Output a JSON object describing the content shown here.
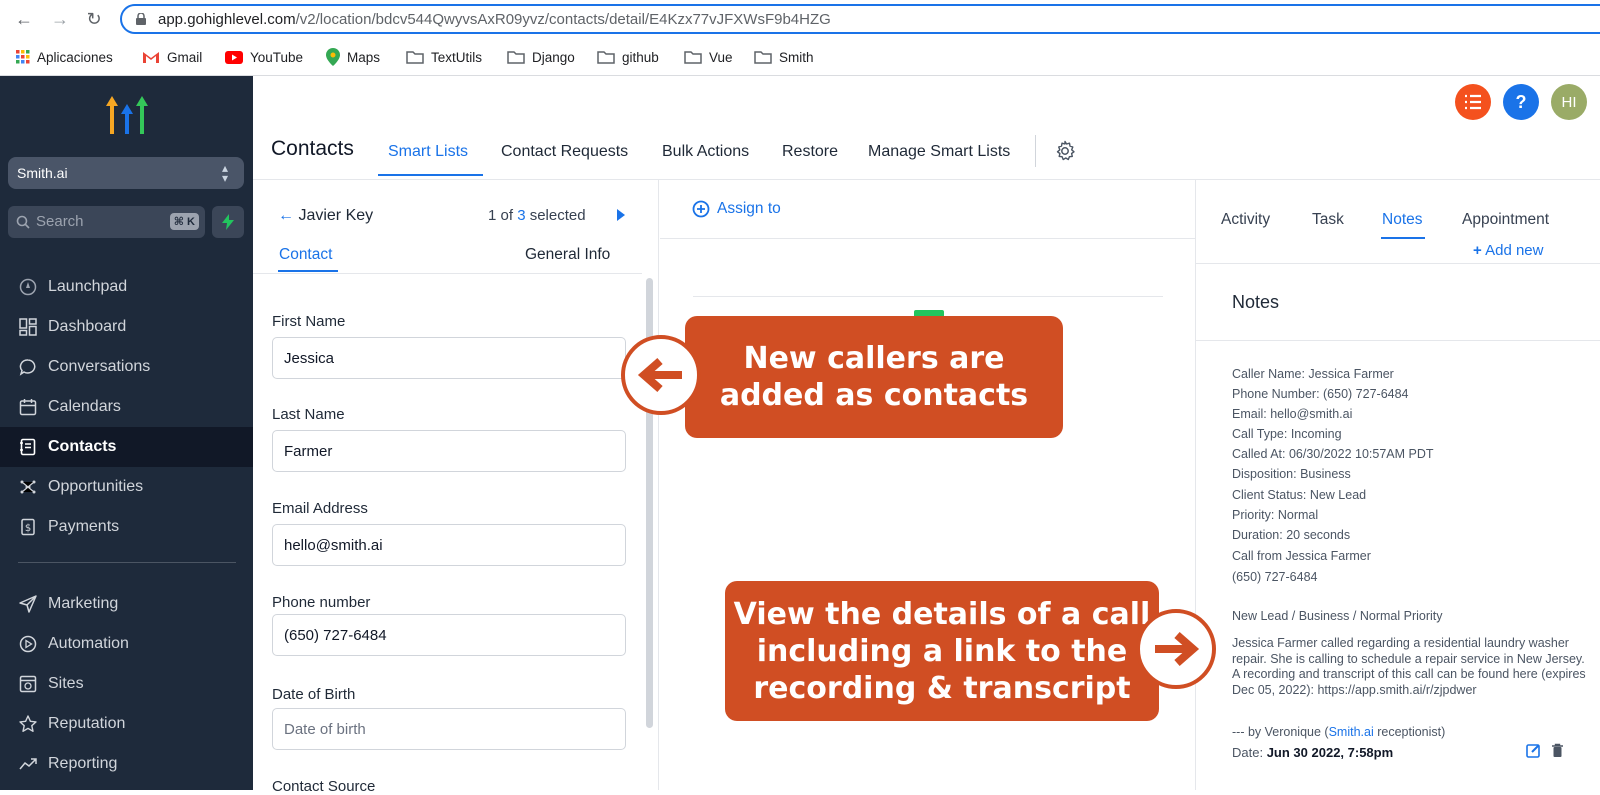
{
  "browser": {
    "url_host": "app.gohighlevel.com",
    "url_path": "/v2/location/bdcv544QwyvsAxR09yvz/contacts/detail/E4Kzx77vJFXWsF9b4HZG",
    "bookmarks": [
      "Aplicaciones",
      "Gmail",
      "YouTube",
      "Maps",
      "TextUtils",
      "Django",
      "github",
      "Vue",
      "Smith"
    ]
  },
  "sidebar": {
    "account": "Smith.ai",
    "search_placeholder": "Search",
    "search_shortcut": "⌘ K",
    "items": [
      {
        "label": "Launchpad",
        "icon": "rocket-icon"
      },
      {
        "label": "Dashboard",
        "icon": "dashboard-icon"
      },
      {
        "label": "Conversations",
        "icon": "chat-icon"
      },
      {
        "label": "Calendars",
        "icon": "calendar-icon"
      },
      {
        "label": "Contacts",
        "icon": "contacts-icon"
      },
      {
        "label": "Opportunities",
        "icon": "opportunities-icon"
      },
      {
        "label": "Payments",
        "icon": "payments-icon"
      },
      {
        "label": "Marketing",
        "icon": "send-icon"
      },
      {
        "label": "Automation",
        "icon": "automation-icon"
      },
      {
        "label": "Sites",
        "icon": "sites-icon"
      },
      {
        "label": "Reputation",
        "icon": "star-icon"
      },
      {
        "label": "Reporting",
        "icon": "trend-icon"
      }
    ],
    "active": "Contacts"
  },
  "header": {
    "title": "Contacts",
    "tabs": [
      "Smart Lists",
      "Contact Requests",
      "Bulk Actions",
      "Restore",
      "Manage Smart Lists"
    ],
    "active_tab": "Smart Lists",
    "avatar_initials": "HI",
    "help_label": "?"
  },
  "contact_panel": {
    "back_label": "Javier Key",
    "count_prefix": "1 of",
    "count_num": "3",
    "count_suffix": "selected",
    "tabs": [
      "Contact",
      "General Info"
    ],
    "fields": [
      {
        "label": "First Name",
        "value": "Jessica",
        "placeholder": ""
      },
      {
        "label": "Last Name",
        "value": "Farmer",
        "placeholder": ""
      },
      {
        "label": "Email Address",
        "value": "hello@smith.ai",
        "placeholder": ""
      },
      {
        "label": "Phone number",
        "value": "(650) 727-6484",
        "placeholder": ""
      },
      {
        "label": "Date of Birth",
        "value": "",
        "placeholder": "Date of birth"
      }
    ],
    "next_label": "Contact Source"
  },
  "middle": {
    "assign_label": "Assign to"
  },
  "notes_panel": {
    "tabs": [
      "Activity",
      "Task",
      "Notes",
      "Appointment"
    ],
    "active_tab": "Notes",
    "add_new": "Add new",
    "title": "Notes",
    "lines": [
      "Caller Name: Jessica Farmer",
      "Phone Number: (650) 727-6484",
      "Email: hello@smith.ai",
      "Call Type: Incoming",
      "Called At: 06/30/2022 10:57AM PDT",
      "Disposition: Business",
      "Client Status: New Lead",
      "Priority: Normal",
      "Duration: 20 seconds",
      "Call from Jessica Farmer",
      "(650) 727-6484"
    ],
    "summary": "New Lead / Business / Normal Priority",
    "paragraph": "Jessica Farmer called regarding a residential laundry washer repair. She is calling to schedule a repair service in New Jersey. A recording and transcript of this call can be found here (expires Dec 05, 2022): https://app.smith.ai/r/zjpdwer",
    "signature_prefix": "--- by Veronique (",
    "signature_link": "Smith.ai",
    "signature_suffix": " receptionist)",
    "date_label": "Date:",
    "date_value": "Jun 30 2022, 7:58pm"
  },
  "callouts": {
    "top": [
      "New callers are",
      "added as contacts"
    ],
    "bottom": [
      "View the details of a call",
      "including a link to the",
      "recording & transcript"
    ]
  },
  "colors": {
    "sidebar_bg": "#1e2a3b",
    "accent": "#1a73e8",
    "callout": "#d04e23",
    "orange_btn": "#f4511e",
    "avatar": "#9aab67"
  }
}
